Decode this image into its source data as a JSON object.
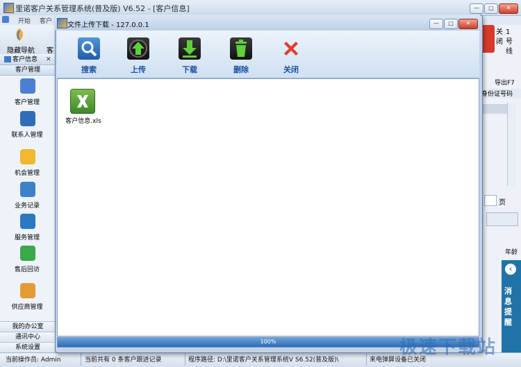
{
  "main": {
    "title": "里诺客户关系管理系统(普及版) V6.52 - [客户信息]",
    "menu": {
      "start": "开始",
      "customer": "客户"
    },
    "toolbar": {
      "hidden_nav": "隐藏导航",
      "more": "客"
    },
    "nav": {
      "tab_customer_info": "客户信息",
      "tab_customer_mgmt": "客户管理",
      "items": [
        {
          "label": "客户管理",
          "icon": "users-icon"
        },
        {
          "label": "联系人管理",
          "icon": "contact-icon"
        },
        {
          "label": "机会管理",
          "icon": "star-icon"
        },
        {
          "label": "业务记录",
          "icon": "chart-icon"
        },
        {
          "label": "服务管理",
          "icon": "globe-icon"
        },
        {
          "label": "售后回访",
          "icon": "chat-icon"
        },
        {
          "label": "供应商管理",
          "icon": "supplier-icon"
        }
      ],
      "bottom_tabs": [
        "我的办公室",
        "通讯中心",
        "系统设置"
      ]
    },
    "right": {
      "close_label": "关\n闭",
      "no_label": "1\n号\n线",
      "export_label": "导出F7",
      "id_label": "身份证号码",
      "page_label": "页",
      "year_label": "年龄",
      "msg_label": "消息提醒"
    },
    "status": {
      "operator": "当前操作员: Admin",
      "count": "当前共有 0 条客户跟进记录",
      "path": "程序路径: D:\\里诺客户关系管理系统V S6.52(普及版)\\",
      "device": "来电弹屏设备已关闭"
    }
  },
  "dialog": {
    "title": "文件上传下载 - 127.0.0.1",
    "toolbar": [
      {
        "label": "搜索",
        "icon": "search-icon"
      },
      {
        "label": "上传",
        "icon": "upload-icon"
      },
      {
        "label": "下载",
        "icon": "download-icon"
      },
      {
        "label": "删除",
        "icon": "trash-icon"
      },
      {
        "label": "关闭",
        "icon": "close-x-icon"
      }
    ],
    "files": [
      {
        "name": "客户信息.xls",
        "icon": "excel-file-icon"
      }
    ],
    "progress": {
      "value": 100,
      "text": "100%"
    }
  },
  "watermark": "极速下载站",
  "colors": {
    "accent": "#1a4fa0",
    "progress": "#2e6cb6",
    "titlebar": "#cfdbeb"
  }
}
